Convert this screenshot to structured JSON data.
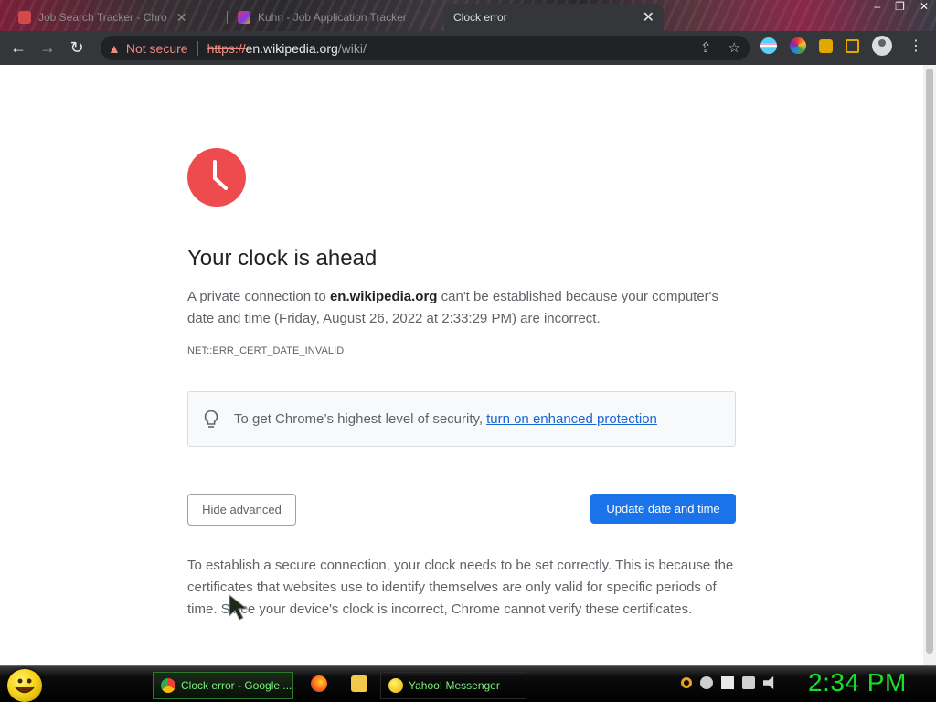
{
  "browser": {
    "tabs": [
      {
        "title": "Job Search Tracker - Chro",
        "active": false
      },
      {
        "title": "Kuhn - Job Application Tracker",
        "active": false
      },
      {
        "title": "Clock error",
        "active": true
      }
    ],
    "window_controls": [
      "–",
      "❐",
      "✕"
    ],
    "toolbar": {
      "security_label": "Not secure",
      "url_protocol": "https://",
      "url_host": "en.wikipedia.org",
      "url_path": "/wiki/"
    }
  },
  "page": {
    "title": "Your clock is ahead",
    "description": {
      "prefix": "A private connection to ",
      "host": "en.wikipedia.org",
      "suffix": " can't be established because your computer's date and time (Friday, August 26, 2022 at 2:33:29 PM) are incorrect."
    },
    "error_code": "NET::ERR_CERT_DATE_INVALID",
    "tip": {
      "text": "To get Chrome’s highest level of security,",
      "link": "turn on enhanced protection"
    },
    "buttons": {
      "hide_advanced": "Hide advanced",
      "update": "Update date and time"
    },
    "details": "To establish a secure connection, your clock needs to be set correctly. This is because the certificates that websites use to identify themselves are only valid for specific periods of time. Since your device's clock is incorrect, Chrome cannot verify these certificates."
  },
  "taskbar": {
    "items": [
      {
        "label": "Clock error - Google ..."
      },
      {
        "label": "Yahoo! Messenger"
      }
    ],
    "clock": "2:34 PM"
  },
  "colors": {
    "accent": "#1a73e8",
    "error_red": "#ee4b4f",
    "toolbar_bg": "#35363a",
    "taskbar_clock": "#16e02a"
  }
}
